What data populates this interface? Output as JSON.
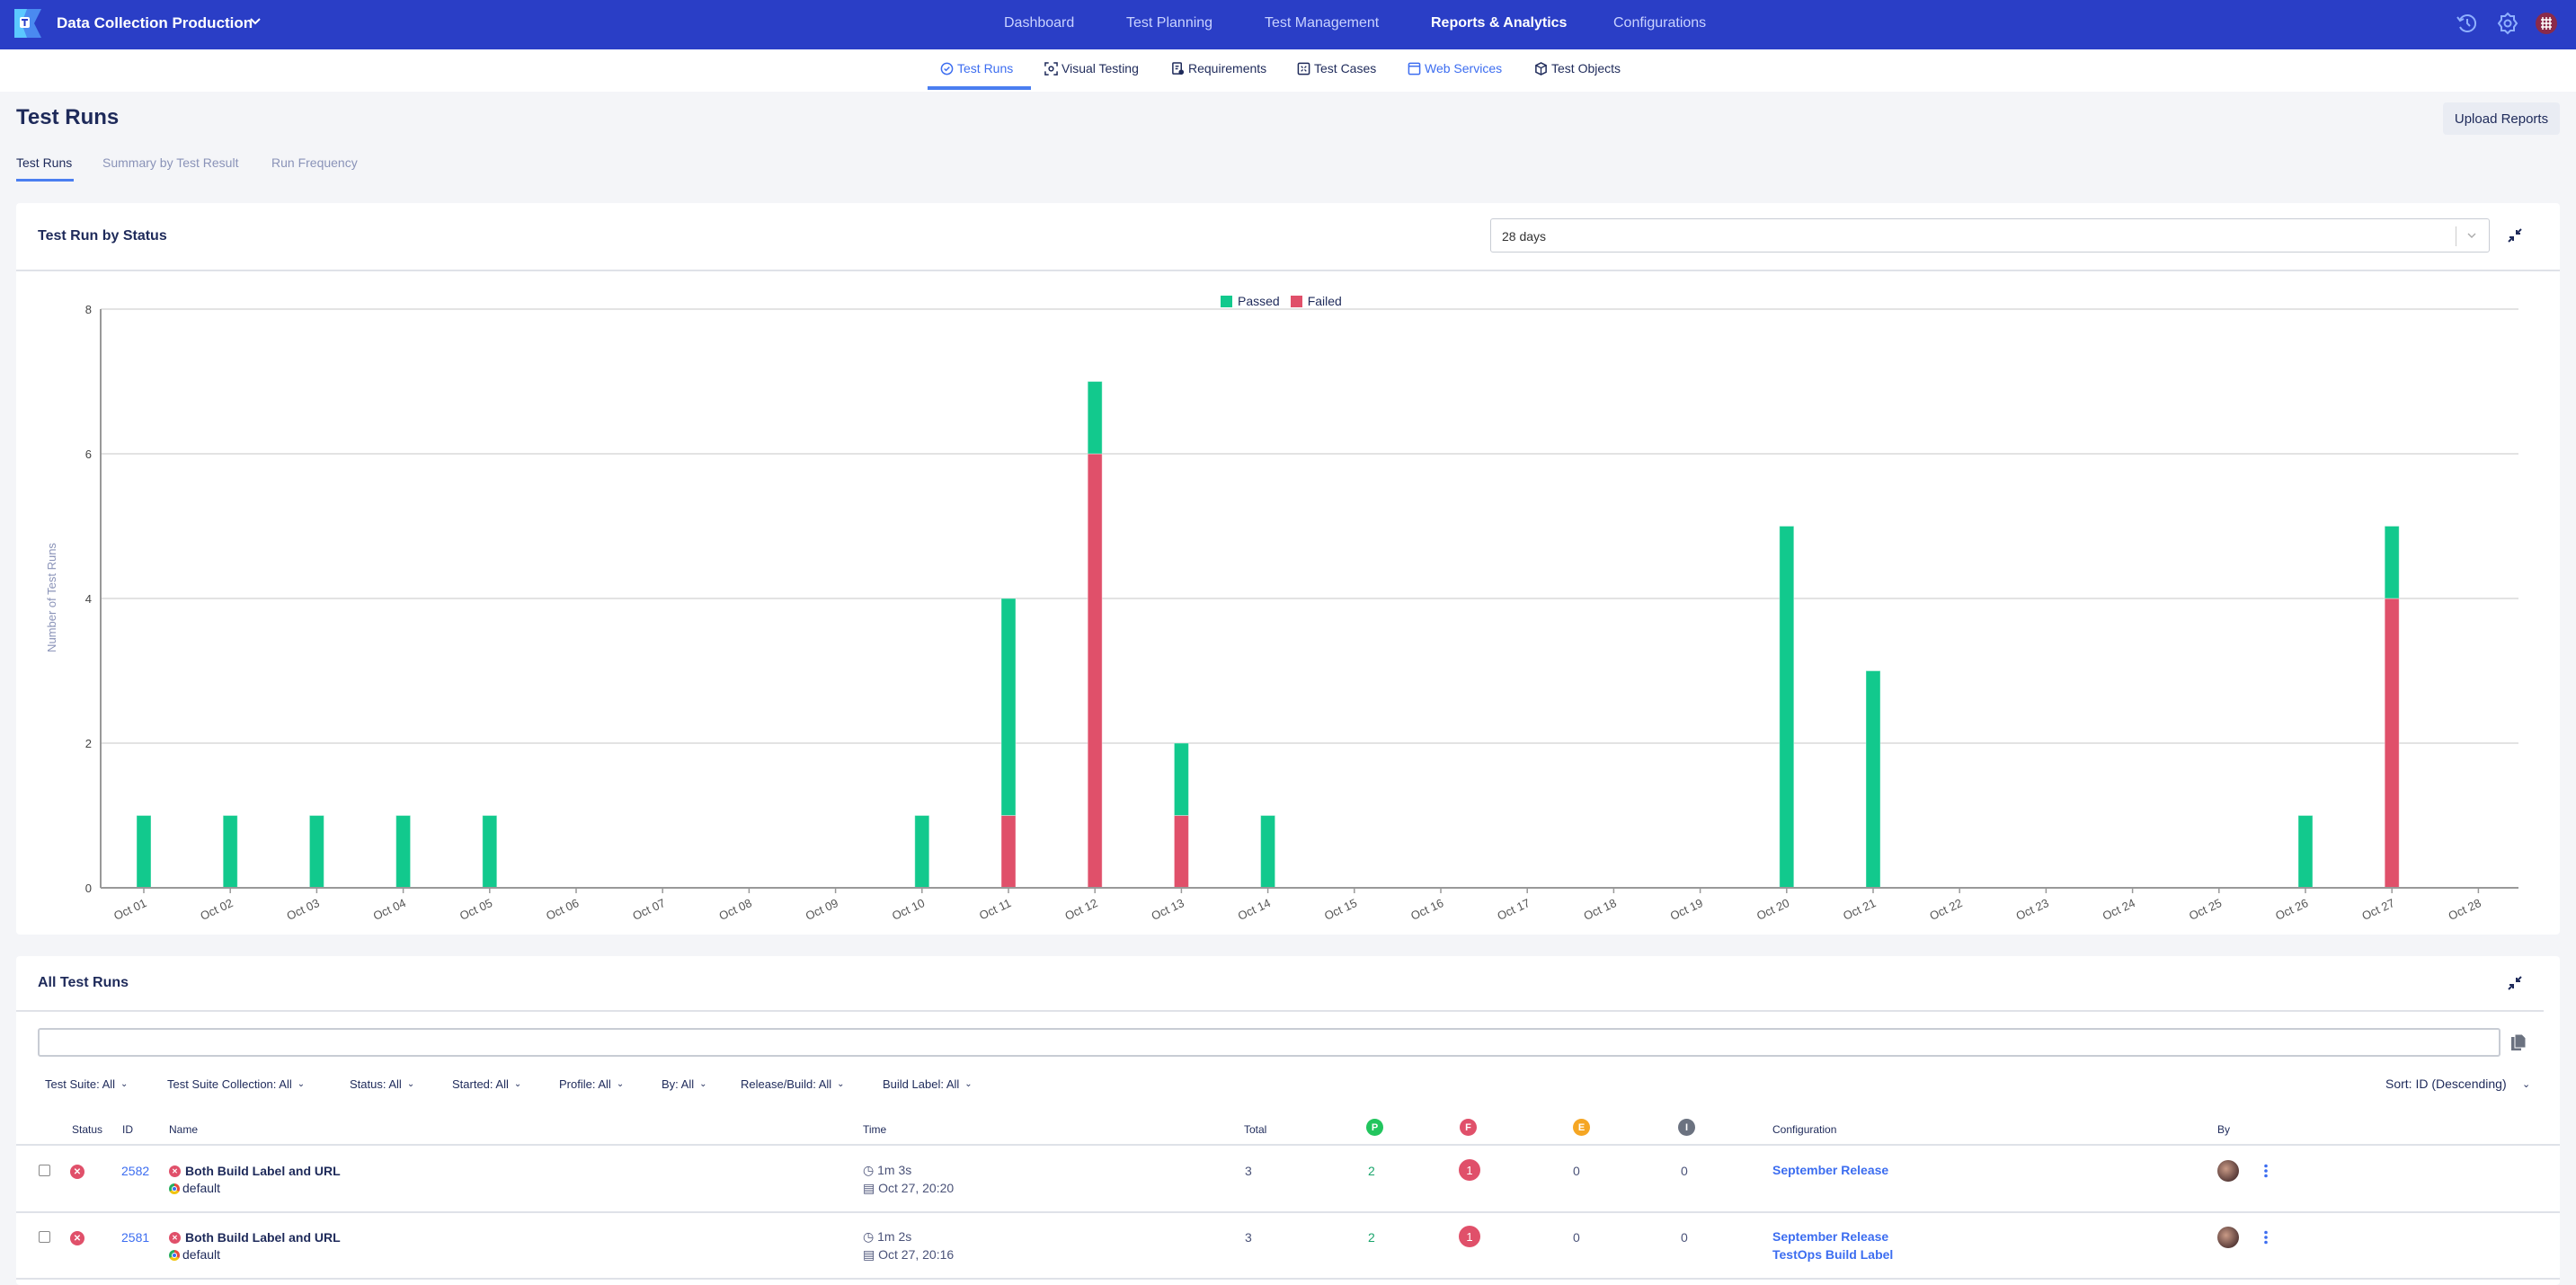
{
  "header": {
    "project": "Data Collection Production",
    "nav": [
      "Dashboard",
      "Test Planning",
      "Test Management",
      "Reports & Analytics",
      "Configurations"
    ],
    "active_nav": "Reports & Analytics",
    "icons": [
      "history-icon",
      "gear-icon",
      "user-avatar"
    ]
  },
  "subnav": {
    "tabs": [
      {
        "label": "Test Runs",
        "icon": "check-circle-icon"
      },
      {
        "label": "Visual Testing",
        "icon": "visual-scan-icon"
      },
      {
        "label": "Requirements",
        "icon": "requirements-icon"
      },
      {
        "label": "Test Cases",
        "icon": "test-case-icon"
      },
      {
        "label": "Web Services",
        "icon": "window-icon"
      },
      {
        "label": "Test Objects",
        "icon": "cube-icon"
      }
    ],
    "active": "Test Runs"
  },
  "page": {
    "title": "Test Runs",
    "upload_label": "Upload Reports",
    "tabs": [
      "Test Runs",
      "Summary by Test Result",
      "Run Frequency"
    ],
    "active_tab": "Test Runs"
  },
  "chart_card": {
    "title": "Test Run by Status",
    "range": "28 days"
  },
  "chart_data": {
    "type": "bar",
    "stacked": true,
    "title": "Test Run by Status",
    "xlabel": "",
    "ylabel": "Number of Test Runs",
    "ylim": [
      0,
      8
    ],
    "yticks": [
      0,
      2,
      4,
      6,
      8
    ],
    "grid": true,
    "legend": "top-center",
    "categories": [
      "Oct 01",
      "Oct 02",
      "Oct 03",
      "Oct 04",
      "Oct 05",
      "Oct 06",
      "Oct 07",
      "Oct 08",
      "Oct 09",
      "Oct 10",
      "Oct 11",
      "Oct 12",
      "Oct 13",
      "Oct 14",
      "Oct 15",
      "Oct 16",
      "Oct 17",
      "Oct 18",
      "Oct 19",
      "Oct 20",
      "Oct 21",
      "Oct 22",
      "Oct 23",
      "Oct 24",
      "Oct 25",
      "Oct 26",
      "Oct 27",
      "Oct 28"
    ],
    "series": [
      {
        "name": "Failed",
        "color": "#e0506a",
        "values": [
          0,
          0,
          0,
          0,
          0,
          0,
          0,
          0,
          0,
          0,
          1,
          6,
          1,
          0,
          0,
          0,
          0,
          0,
          0,
          0,
          0,
          0,
          0,
          0,
          0,
          0,
          4,
          0
        ]
      },
      {
        "name": "Passed",
        "color": "#12c98d",
        "values": [
          1,
          1,
          1,
          1,
          1,
          0,
          0,
          0,
          0,
          1,
          3,
          1,
          1,
          1,
          0,
          0,
          0,
          0,
          0,
          5,
          3,
          0,
          0,
          0,
          0,
          1,
          1,
          0
        ]
      }
    ],
    "legend_order": [
      "Passed",
      "Failed"
    ]
  },
  "runs_card": {
    "title": "All Test Runs",
    "search_value": "",
    "filters": [
      "Test Suite: All",
      "Test Suite Collection: All",
      "Status: All",
      "Started: All",
      "Profile: All",
      "By: All",
      "Release/Build: All",
      "Build Label: All"
    ],
    "sort": "Sort:  ID (Descending)",
    "columns": {
      "status": "Status",
      "id": "ID",
      "name": "Name",
      "time": "Time",
      "total": "Total",
      "passed": "P",
      "failed": "F",
      "error": "E",
      "incomplete": "I",
      "configuration": "Configuration",
      "by": "By"
    },
    "rows": [
      {
        "id": "2582",
        "name": "Both Build Label and URL",
        "profile": "default",
        "duration": "1m 3s",
        "started": "Oct 27, 20:20",
        "total": "3",
        "passed": "2",
        "failed": "1",
        "error": "0",
        "incomplete": "0",
        "configuration": [
          "September Release"
        ],
        "status": "failed"
      },
      {
        "id": "2581",
        "name": "Both Build Label and URL",
        "profile": "default",
        "duration": "1m 2s",
        "started": "Oct 27, 20:16",
        "total": "3",
        "passed": "2",
        "failed": "1",
        "error": "0",
        "incomplete": "0",
        "configuration": [
          "September Release",
          "TestOps Build Label"
        ],
        "status": "failed"
      }
    ]
  },
  "colors": {
    "brand": "#2a3ec6",
    "passed": "#12c98d",
    "failed": "#e0506a",
    "error": "#f5a623",
    "incomplete": "#6b7280",
    "link": "#3c6df0"
  }
}
